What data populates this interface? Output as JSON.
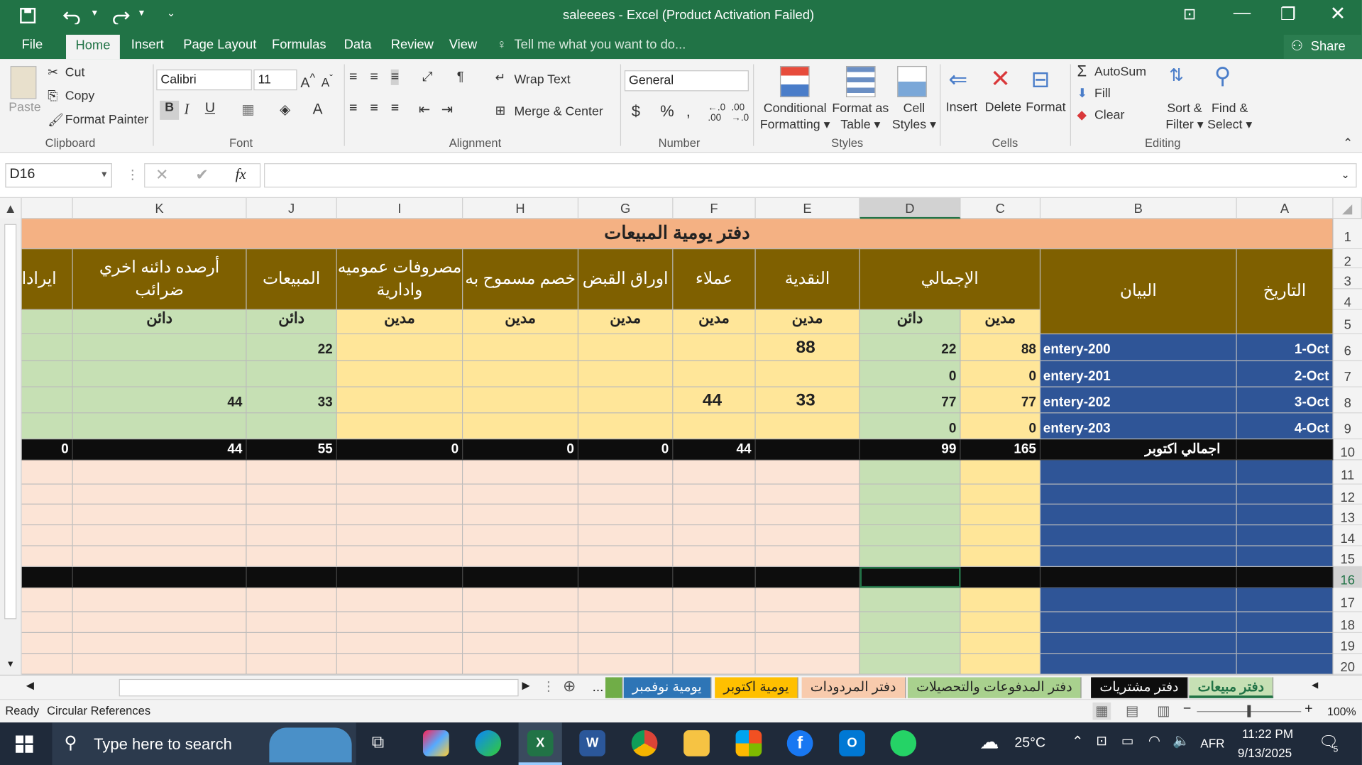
{
  "window": {
    "title": "saleeees - Excel (Product Activation Failed)",
    "share": "Share"
  },
  "qat": {
    "save": "save",
    "undo": "undo",
    "redo": "redo"
  },
  "ribbon_tabs": [
    "File",
    "Home",
    "Insert",
    "Page Layout",
    "Formulas",
    "Data",
    "Review",
    "View"
  ],
  "tell_me": "Tell me what you want to do...",
  "clipboard": {
    "paste": "Paste",
    "cut": "Cut",
    "copy": "Copy",
    "format_painter": "Format Painter",
    "group": "Clipboard"
  },
  "font": {
    "name": "Calibri",
    "size": "11",
    "group": "Font"
  },
  "alignment": {
    "wrap": "Wrap Text",
    "merge": "Merge & Center",
    "group": "Alignment"
  },
  "number": {
    "format": "General",
    "group": "Number"
  },
  "styles": {
    "cond1": "Conditional",
    "cond2": "Formatting",
    "fmt1": "Format as",
    "fmt2": "Table",
    "cell1": "Cell",
    "cell2": "Styles",
    "group": "Styles"
  },
  "cells": {
    "insert": "Insert",
    "delete": "Delete",
    "format": "Format",
    "group": "Cells"
  },
  "editing": {
    "autosum": "AutoSum",
    "fill": "Fill",
    "clear": "Clear",
    "sort1": "Sort &",
    "sort2": "Filter",
    "find1": "Find &",
    "find2": "Select",
    "group": "Editing"
  },
  "namebox": "D16",
  "columns": [
    "K",
    "J",
    "I",
    "H",
    "G",
    "F",
    "E",
    "D",
    "C",
    "B",
    "A"
  ],
  "rows": [
    "1",
    "2",
    "3",
    "4",
    "5",
    "6",
    "7",
    "8",
    "9",
    "10",
    "11",
    "12",
    "13",
    "14",
    "15",
    "16",
    "17",
    "18",
    "19",
    "20"
  ],
  "sheet": {
    "title": "دفتر يومية المبيعات",
    "h_date": "التاريخ",
    "h_desc": "البيان",
    "h_total": "الإجمالي",
    "h_cash": "النقدية",
    "h_clients": "عملاء",
    "h_notes": "اوراق القبض",
    "h_discount": "خصم مسموح به",
    "h_expenses": "مصروفات عموميه وادارية",
    "h_sales": "المبيعات",
    "h_other": "أرصده دائنه اخري ضرائب",
    "h_rev": "ايرادا",
    "debit": "مدين",
    "credit": "دائن",
    "r6": {
      "date": "1-Oct",
      "desc": "entery-200",
      "c": "88",
      "d": "22",
      "e": "88",
      "j": "22"
    },
    "r7": {
      "date": "2-Oct",
      "desc": "entery-201",
      "c": "0",
      "d": "0"
    },
    "r8": {
      "date": "3-Oct",
      "desc": "entery-202",
      "c": "77",
      "d": "77",
      "e": "33",
      "f": "44",
      "j": "33",
      "k": "44"
    },
    "r9": {
      "date": "4-Oct",
      "desc": "entery-203",
      "c": "0",
      "d": "0"
    },
    "r10": {
      "desc": "اجمالي اكتوبر",
      "c": "165",
      "d": "99",
      "f": "44",
      "g": "0",
      "h": "0",
      "i": "0",
      "j": "55",
      "k": "44",
      "rev": "0"
    }
  },
  "sheet_tabs": [
    "دفتر مبيعات",
    "دفتر مشتريات",
    "دفتر المدفوعات والتحصيلات",
    "دفتر المردودات",
    "يومية اكتوبر",
    "يومية نوفمبر",
    "..."
  ],
  "status": {
    "ready": "Ready",
    "circ": "Circular References",
    "zoom": "100%"
  },
  "taskbar": {
    "search": "Type here to search",
    "temp": "25°C",
    "lang": "AFR",
    "time": "11:22 PM",
    "date": "9/13/2025",
    "notif": "5"
  },
  "colors": {
    "excel_green": "#217346",
    "header_brown": "#7f6000",
    "peach": "#f4b183",
    "light_green": "#c6e0b4",
    "light_yellow": "#ffe699",
    "navy": "#2f5597",
    "pink": "#fce4d6"
  }
}
